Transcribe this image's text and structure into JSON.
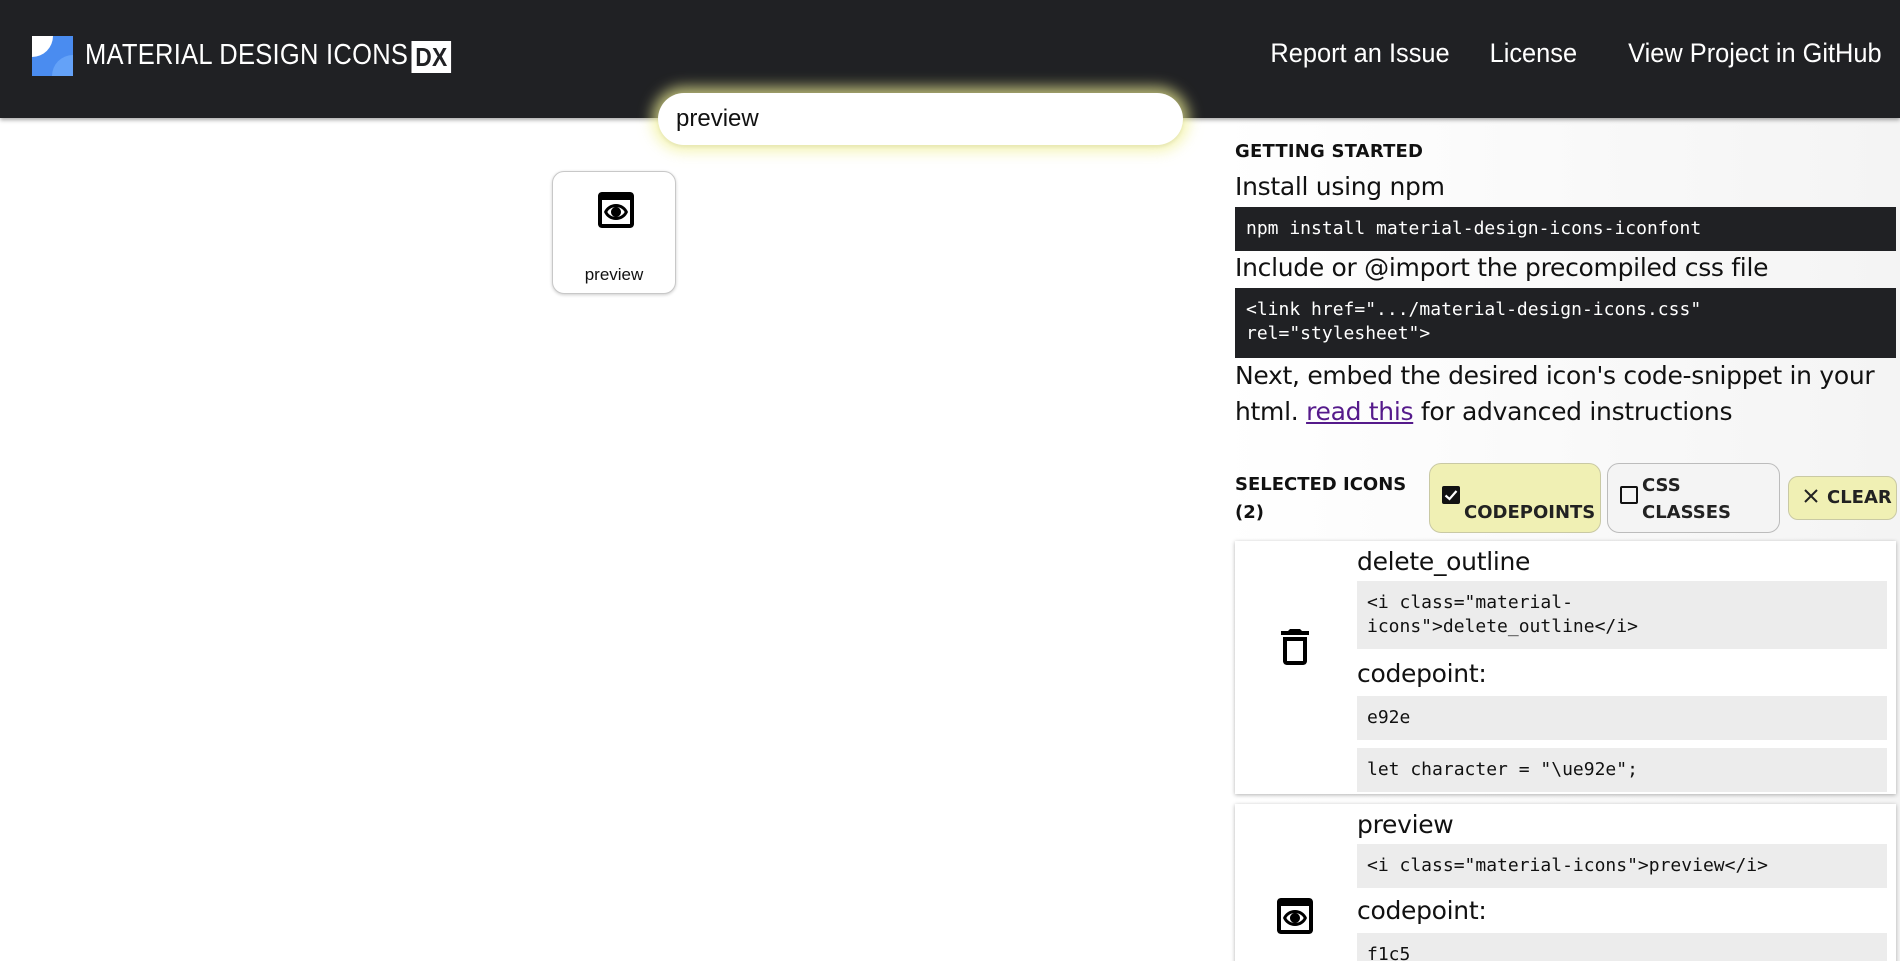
{
  "header": {
    "brand_text": "MATERIAL DESIGN ICONS",
    "brand_badge": "DX",
    "nav": [
      {
        "label": "Report an Issue"
      },
      {
        "label": "License"
      },
      {
        "label": "View Project in GitHub"
      }
    ]
  },
  "search": {
    "value": "preview"
  },
  "results": [
    {
      "label": "preview",
      "icon": "preview-icon"
    }
  ],
  "getting_started": {
    "heading": "GETTING STARTED",
    "install_text": "Install using npm",
    "install_code": "npm install material-design-icons-iconfont",
    "include_text": "Include or @import the precompiled css file",
    "include_code": "<link href=\".../material-design-icons.css\"\nrel=\"stylesheet\">",
    "next_text_1": "Next, embed the desired icon's code-snippet in your html.",
    "next_link": "read this",
    "next_text_2": "for advanced instructions"
  },
  "selected": {
    "heading": "SELECTED ICONS",
    "count": "(2)",
    "codepoints_label": "CODEPOINTS",
    "css_classes_label": "CSS CLASSES",
    "clear_label": "CLEAR",
    "codepoint_label": "codepoint:",
    "items": [
      {
        "name": "delete_outline",
        "icon": "delete-outline-icon",
        "snippet": "<i class=\"material-\nicons\">delete_outline</i>",
        "codepoint": "e92e",
        "js": "let character = \"\\ue92e\";"
      },
      {
        "name": "preview",
        "icon": "preview-icon",
        "snippet": "<i class=\"material-icons\">preview</i>",
        "codepoint": "f1c5"
      }
    ]
  },
  "colors": {
    "header_bg": "#202124",
    "accent_yellow": "#f0f0b4",
    "link": "#551a8b"
  }
}
